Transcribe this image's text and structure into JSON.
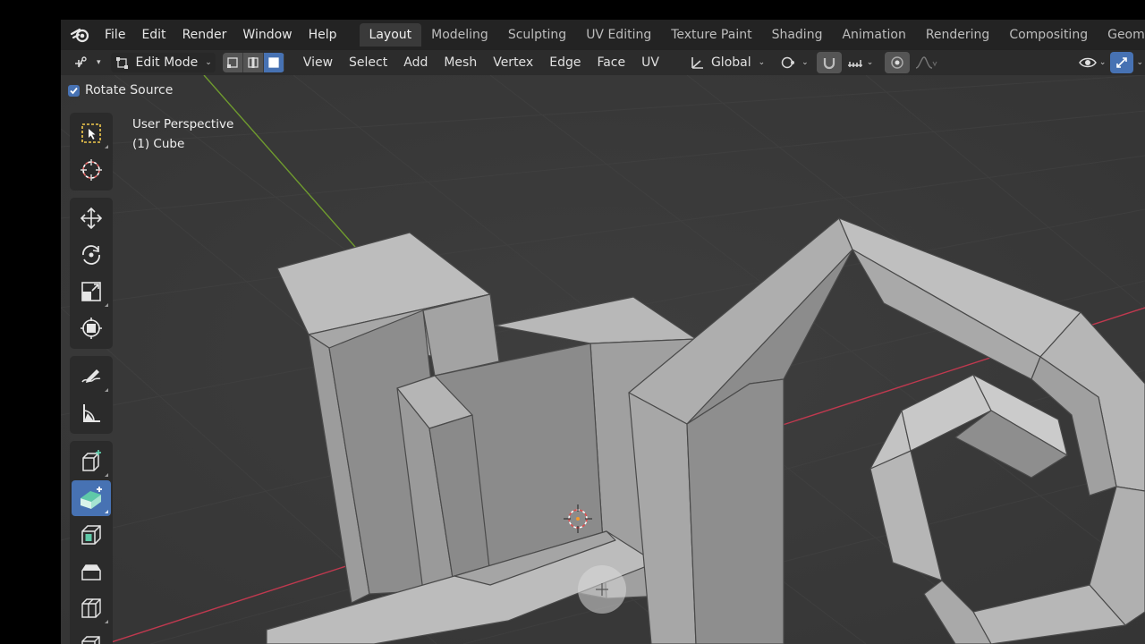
{
  "menu": {
    "items": [
      "File",
      "Edit",
      "Render",
      "Window",
      "Help"
    ]
  },
  "workspaces": [
    "Layout",
    "Modeling",
    "Sculpting",
    "UV Editing",
    "Texture Paint",
    "Shading",
    "Animation",
    "Rendering",
    "Compositing",
    "Geometry N"
  ],
  "active_workspace": "Layout",
  "header": {
    "mode": "Edit Mode",
    "menus": [
      "View",
      "Select",
      "Add",
      "Mesh",
      "Vertex",
      "Edge",
      "Face",
      "UV"
    ],
    "transform_orientation": "Global",
    "select_mode_active": "face"
  },
  "operator": {
    "checkbox_label": "Rotate Source",
    "checked": true
  },
  "viewport": {
    "perspective": "User Perspective",
    "object": "(1) Cube"
  },
  "tools": [
    [
      "select-box-icon",
      "cursor-icon"
    ],
    [
      "move-icon",
      "rotate-icon",
      "scale-icon",
      "transform-icon"
    ],
    [
      "annotate-icon",
      "measure-icon"
    ],
    [
      "add-cube-icon",
      "extrude-region-icon",
      "inset-faces-icon",
      "bevel-icon",
      "loop-cut-icon",
      "knife-icon"
    ]
  ],
  "active_tool": "extrude-region-icon",
  "colors": {
    "accent": "#4772b3",
    "viewport_bg": "#3a3a3a",
    "mesh_face": "#a9a9a9",
    "x_axis": "#c0394f",
    "y_axis": "#6f9b2e"
  }
}
